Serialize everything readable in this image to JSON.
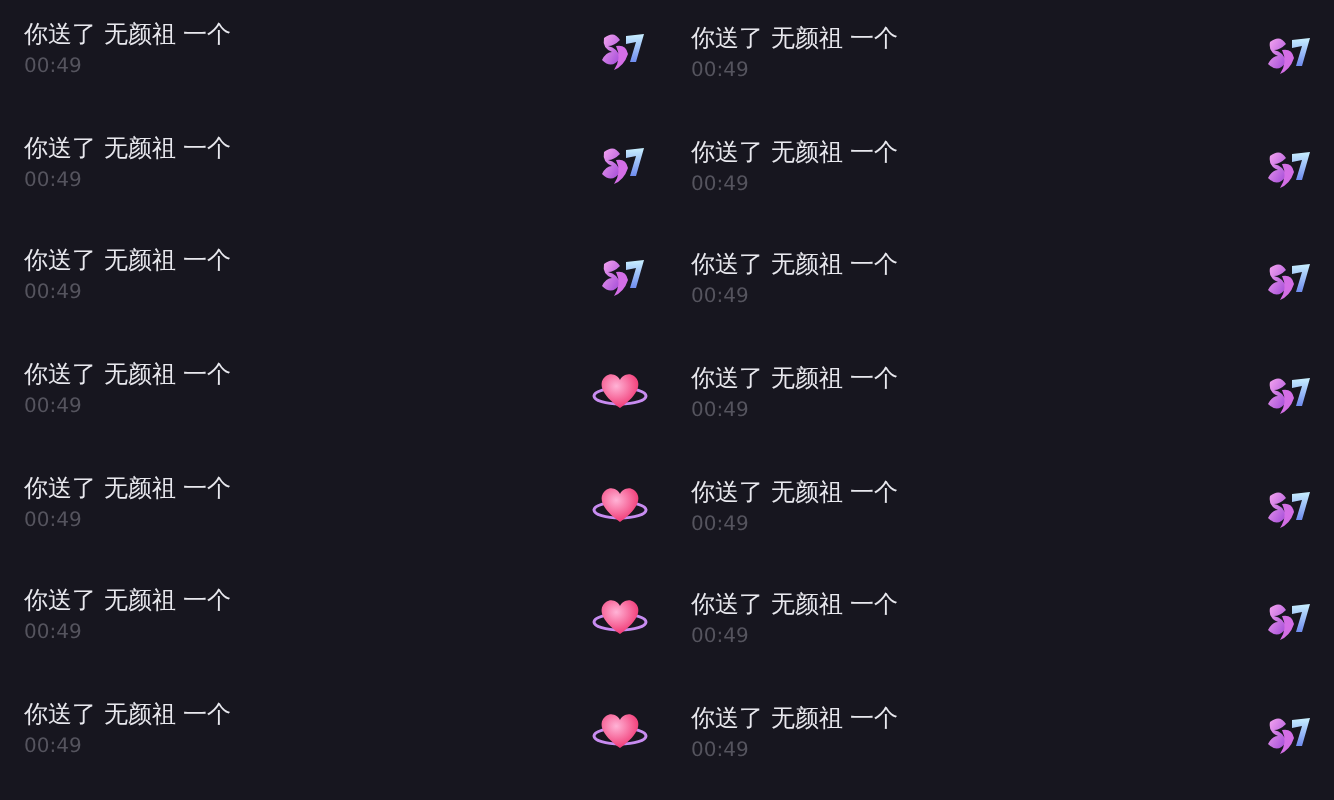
{
  "columns": [
    {
      "items": [
        {
          "message": "你送了 无颜祖 一个",
          "time": "00:49",
          "kind": "sticker"
        },
        {
          "message": "你送了 无颜祖 一个",
          "time": "00:49",
          "kind": "sticker"
        },
        {
          "message": "你送了 无颜祖 一个",
          "time": "00:49",
          "kind": "sticker"
        },
        {
          "message": "你送了 无颜祖 一个",
          "time": "00:49",
          "kind": "heart"
        },
        {
          "message": "你送了 无颜祖 一个",
          "time": "00:49",
          "kind": "heart"
        },
        {
          "message": "你送了 无颜祖 一个",
          "time": "00:49",
          "kind": "heart"
        },
        {
          "message": "你送了 无颜祖 一个",
          "time": "00:49",
          "kind": "heart"
        }
      ]
    },
    {
      "items": [
        {
          "message": "你送了 无颜祖 一个",
          "time": "00:49",
          "kind": "sticker"
        },
        {
          "message": "你送了 无颜祖 一个",
          "time": "00:49",
          "kind": "sticker"
        },
        {
          "message": "你送了 无颜祖 一个",
          "time": "00:49",
          "kind": "sticker"
        },
        {
          "message": "你送了 无颜祖 一个",
          "time": "00:49",
          "kind": "sticker"
        },
        {
          "message": "你送了 无颜祖 一个",
          "time": "00:49",
          "kind": "sticker"
        },
        {
          "message": "你送了 无颜祖 一个",
          "time": "00:49",
          "kind": "sticker"
        },
        {
          "message": "你送了 无颜祖 一个",
          "time": "00:49",
          "kind": "sticker"
        }
      ]
    }
  ]
}
